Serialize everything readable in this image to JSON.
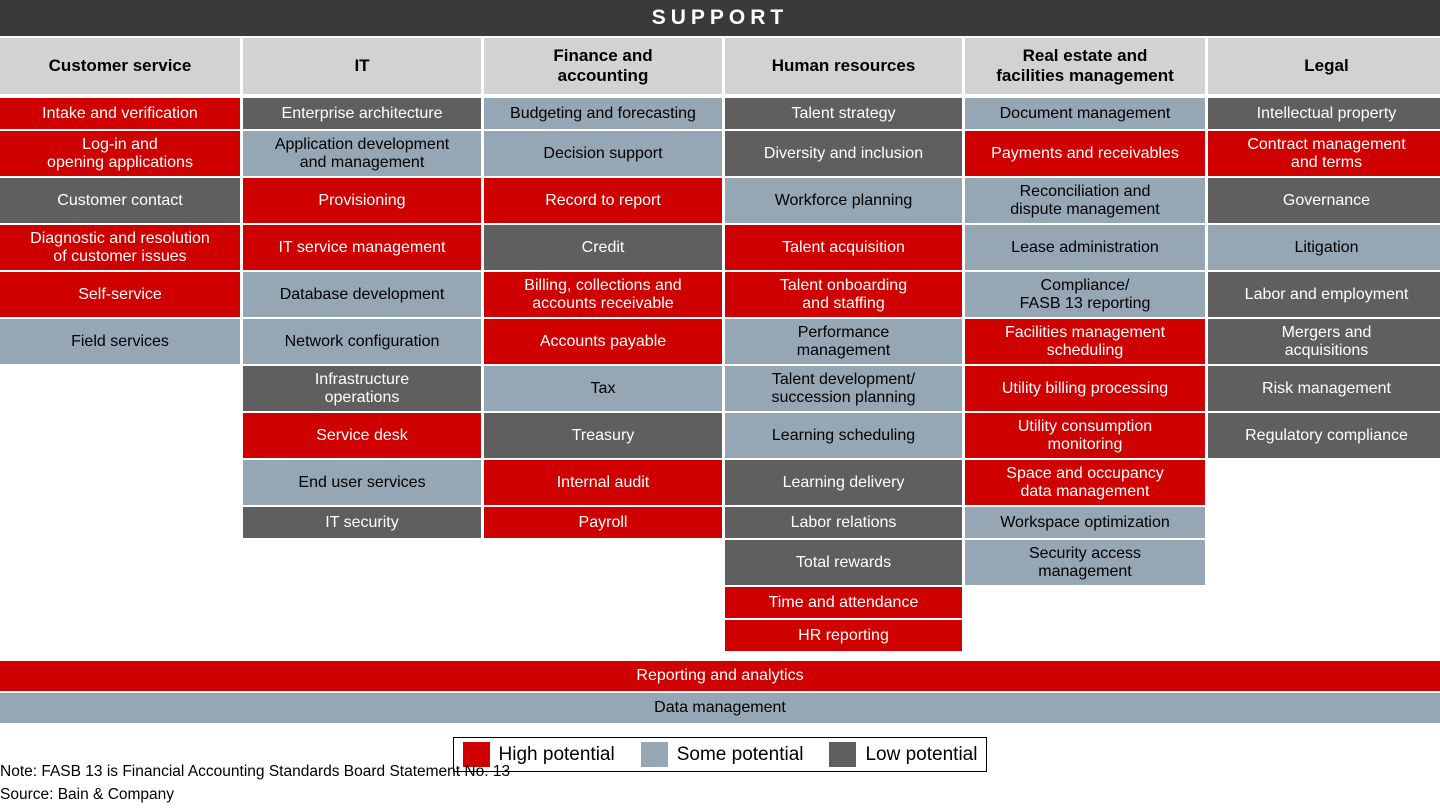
{
  "banner": {
    "title": "SUPPORT"
  },
  "legend_colors": {
    "high": "#cf0000",
    "some": "#95a6b5",
    "low": "#5f5f5f",
    "banner": "#3a3a3a",
    "header": "#d2d2d2"
  },
  "legend": {
    "items": [
      {
        "label": "High potential",
        "level": "high"
      },
      {
        "label": "Some potential",
        "level": "some"
      },
      {
        "label": "Low potential",
        "level": "low"
      }
    ]
  },
  "columns": [
    {
      "header": "Customer service",
      "cells": [
        {
          "label": "Intake and verification",
          "level": "high",
          "lines": 1
        },
        {
          "label": "Log-in and\nopening applications",
          "level": "high",
          "lines": 2
        },
        {
          "label": "Customer contact",
          "level": "low",
          "lines": 2
        },
        {
          "label": "Diagnostic and resolution\nof customer issues",
          "level": "high",
          "lines": 2
        },
        {
          "label": "Self-service",
          "level": "high",
          "lines": 2
        },
        {
          "label": "Field services",
          "level": "some",
          "lines": 2
        }
      ]
    },
    {
      "header": "IT",
      "cells": [
        {
          "label": "Enterprise architecture",
          "level": "low",
          "lines": 1
        },
        {
          "label": "Application development\nand management",
          "level": "some",
          "lines": 2
        },
        {
          "label": "Provisioning",
          "level": "high",
          "lines": 2
        },
        {
          "label": "IT service management",
          "level": "high",
          "lines": 2
        },
        {
          "label": "Database development",
          "level": "some",
          "lines": 2
        },
        {
          "label": "Network configuration",
          "level": "some",
          "lines": 2
        },
        {
          "label": "Infrastructure\noperations",
          "level": "low",
          "lines": 2
        },
        {
          "label": "Service desk",
          "level": "high",
          "lines": 2
        },
        {
          "label": "End user services",
          "level": "some",
          "lines": 2
        },
        {
          "label": "IT security",
          "level": "low",
          "lines": 1
        }
      ]
    },
    {
      "header": "Finance and\naccounting",
      "cells": [
        {
          "label": "Budgeting and forecasting",
          "level": "some",
          "lines": 1
        },
        {
          "label": "Decision support",
          "level": "some",
          "lines": 2
        },
        {
          "label": "Record to report",
          "level": "high",
          "lines": 2
        },
        {
          "label": "Credit",
          "level": "low",
          "lines": 2
        },
        {
          "label": "Billing, collections and\naccounts receivable",
          "level": "high",
          "lines": 2
        },
        {
          "label": "Accounts payable",
          "level": "high",
          "lines": 2
        },
        {
          "label": "Tax",
          "level": "some",
          "lines": 2
        },
        {
          "label": "Treasury",
          "level": "low",
          "lines": 2
        },
        {
          "label": "Internal audit",
          "level": "high",
          "lines": 2
        },
        {
          "label": "Payroll",
          "level": "high",
          "lines": 1
        }
      ]
    },
    {
      "header": "Human resources",
      "cells": [
        {
          "label": "Talent strategy",
          "level": "low",
          "lines": 1
        },
        {
          "label": "Diversity and inclusion",
          "level": "low",
          "lines": 2
        },
        {
          "label": "Workforce planning",
          "level": "some",
          "lines": 2
        },
        {
          "label": "Talent acquisition",
          "level": "high",
          "lines": 2
        },
        {
          "label": "Talent onboarding\nand staffing",
          "level": "high",
          "lines": 2
        },
        {
          "label": "Performance\nmanagement",
          "level": "some",
          "lines": 2
        },
        {
          "label": "Talent development/\nsuccession planning",
          "level": "some",
          "lines": 2
        },
        {
          "label": "Learning scheduling",
          "level": "some",
          "lines": 2
        },
        {
          "label": "Learning delivery",
          "level": "low",
          "lines": 2
        },
        {
          "label": "Labor relations",
          "level": "low",
          "lines": 1
        },
        {
          "label": "Total rewards",
          "level": "low",
          "lines": 2
        },
        {
          "label": "Time and attendance",
          "level": "high",
          "lines": 1
        },
        {
          "label": "HR reporting",
          "level": "high",
          "lines": 1
        }
      ]
    },
    {
      "header": "Real estate and\nfacilities management",
      "cells": [
        {
          "label": "Document management",
          "level": "some",
          "lines": 1
        },
        {
          "label": "Payments and receivables",
          "level": "high",
          "lines": 2
        },
        {
          "label": "Reconciliation and\ndispute management",
          "level": "some",
          "lines": 2
        },
        {
          "label": "Lease administration",
          "level": "some",
          "lines": 2
        },
        {
          "label": "Compliance/\nFASB 13 reporting",
          "level": "some",
          "lines": 2
        },
        {
          "label": "Facilities management\nscheduling",
          "level": "high",
          "lines": 2
        },
        {
          "label": "Utility billing processing",
          "level": "high",
          "lines": 2
        },
        {
          "label": "Utility consumption\nmonitoring",
          "level": "high",
          "lines": 2
        },
        {
          "label": "Space and occupancy\ndata management",
          "level": "high",
          "lines": 2
        },
        {
          "label": "Workspace optimization",
          "level": "some",
          "lines": 1
        },
        {
          "label": "Security access\nmanagement",
          "level": "some",
          "lines": 2
        }
      ]
    },
    {
      "header": "Legal",
      "cells": [
        {
          "label": "Intellectual property",
          "level": "low",
          "lines": 1
        },
        {
          "label": "Contract management\nand terms",
          "level": "high",
          "lines": 2
        },
        {
          "label": "Governance",
          "level": "low",
          "lines": 2
        },
        {
          "label": "Litigation",
          "level": "some",
          "lines": 2
        },
        {
          "label": "Labor and employment",
          "level": "low",
          "lines": 2
        },
        {
          "label": "Mergers and\nacquisitions",
          "level": "low",
          "lines": 2
        },
        {
          "label": "Risk management",
          "level": "low",
          "lines": 2
        },
        {
          "label": "Regulatory compliance",
          "level": "low",
          "lines": 2
        }
      ]
    }
  ],
  "full_width_rows": [
    {
      "label": "Reporting and analytics",
      "level": "high"
    },
    {
      "label": "Data management",
      "level": "some"
    }
  ],
  "footnotes": {
    "note": "Note: FASB 13 is Financial Accounting Standards Board Statement No. 13",
    "source": "Source: Bain & Company"
  }
}
